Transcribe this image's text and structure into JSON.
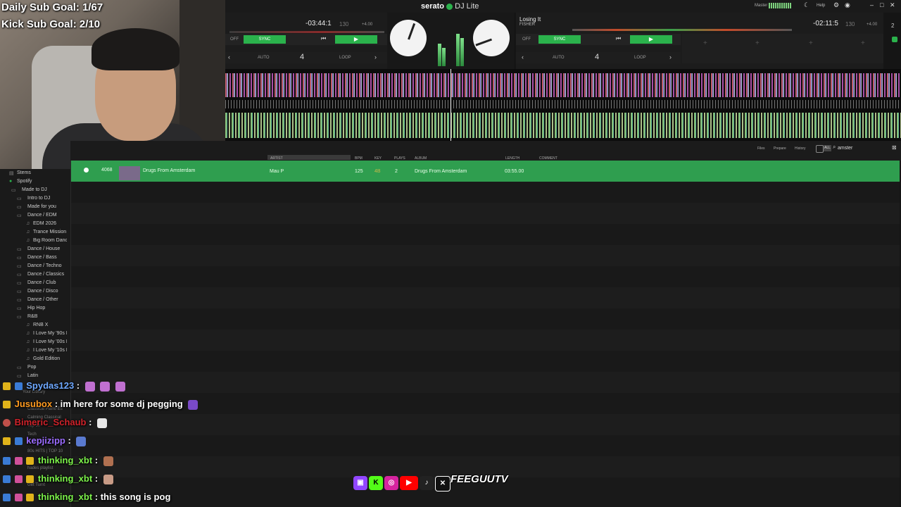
{
  "overlay": {
    "daily_goal": "Daily Sub Goal: 1/67",
    "kick_goal": "Kick Sub Goal: 2/10",
    "webcam_tag": "ahhp",
    "brand_text": "FEEGUUTV"
  },
  "app": {
    "name": "serato",
    "edition": "DJ Lite",
    "master_label": "Master",
    "help_label": "Help",
    "deck_count": "2"
  },
  "deck1": {
    "time": "-03:44:1",
    "bpm": "130",
    "pitch": "+4.00",
    "off": "OFF",
    "sync": "SYNC",
    "auto": "AUTO",
    "loop_size": "4",
    "loop": "LOOP"
  },
  "deck2": {
    "title": "Losing It",
    "artist": "FISHER",
    "time": "-02:11:5",
    "bpm": "130",
    "pitch": "+4.00",
    "off": "OFF",
    "sync": "SYNC",
    "auto": "AUTO",
    "loop_size": "4",
    "loop": "LOOP"
  },
  "library": {
    "columns": [
      "ARTIST",
      "BPM",
      "KEY",
      "PLAYS",
      "ALBUM",
      "LENGTH",
      "COMMENT"
    ],
    "tabs": [
      "Files",
      "Prepare",
      "History"
    ],
    "all_label": "ALL",
    "search_value": "amster",
    "track": {
      "num": "4068",
      "title": "Drugs From Amsterdam",
      "artist": "Mau P",
      "bpm": "125",
      "key": "4B",
      "plays": "2",
      "album": "Drugs From Amsterdam",
      "length": "03:55.00"
    }
  },
  "sidebar": {
    "items": [
      {
        "label": "Stems",
        "indent": 0
      },
      {
        "label": "Spotify",
        "indent": 0
      },
      {
        "label": "Made to DJ",
        "indent": 1
      },
      {
        "label": "Intro to DJ",
        "indent": 2
      },
      {
        "label": "Made for you",
        "indent": 2
      },
      {
        "label": "Dance / EDM",
        "indent": 2
      },
      {
        "label": "EDM 2026",
        "indent": 3
      },
      {
        "label": "Trance Mission",
        "indent": 3
      },
      {
        "label": "Big Room Dance",
        "indent": 3
      },
      {
        "label": "Dance / House",
        "indent": 2
      },
      {
        "label": "Dance / Bass",
        "indent": 2
      },
      {
        "label": "Dance / Techno",
        "indent": 2
      },
      {
        "label": "Dance / Classics",
        "indent": 2
      },
      {
        "label": "Dance / Club",
        "indent": 2
      },
      {
        "label": "Dance / Disco",
        "indent": 2
      },
      {
        "label": "Dance / Other",
        "indent": 2
      },
      {
        "label": "Hip Hop",
        "indent": 2
      },
      {
        "label": "R&B",
        "indent": 2
      },
      {
        "label": "RNB X",
        "indent": 3
      },
      {
        "label": "I Love My '90s R",
        "indent": 3
      },
      {
        "label": "I Love My '00s R",
        "indent": 3
      },
      {
        "label": "I Love My '10s R",
        "indent": 3
      },
      {
        "label": "Gold Edition",
        "indent": 3
      },
      {
        "label": "Pop",
        "indent": 2
      },
      {
        "label": "Latin",
        "indent": 2
      }
    ],
    "hidden_items": [
      "Your Library",
      "Classical Piano Es",
      "Calming Classical",
      "Top 50",
      "Tech",
      "80s HITS | TOP 10",
      "hades playlist",
      "Get Turnt"
    ]
  },
  "chat": [
    {
      "user": "Spydas123",
      "text": "",
      "color": "#6ea8ff",
      "emote": "#c070d0"
    },
    {
      "user": "Jusubox",
      "text": "im here for some dj pegging",
      "color": "#ff9a1f",
      "emote": "#7a4ac8"
    },
    {
      "user": "Bimeric_Schaub",
      "text": "",
      "color": "#d0222a",
      "emote": "#e8e8e8"
    },
    {
      "user": "kepjizipp",
      "text": "",
      "color": "#9b6cff",
      "emote": "#5a7ad0"
    },
    {
      "user": "thinking_xbt",
      "text": "",
      "color": "#7cf24a",
      "emote": "#b07050"
    },
    {
      "user": "thinking_xbt",
      "text": "",
      "color": "#7cf24a",
      "emote": "#c89b86"
    },
    {
      "user": "thinking_xbt",
      "text": "this song is pog",
      "color": "#7cf24a",
      "emote": ""
    }
  ],
  "colors": {
    "accent_green": "#2bb24c",
    "track_row": "#2f9e4f",
    "background": "#151515"
  }
}
